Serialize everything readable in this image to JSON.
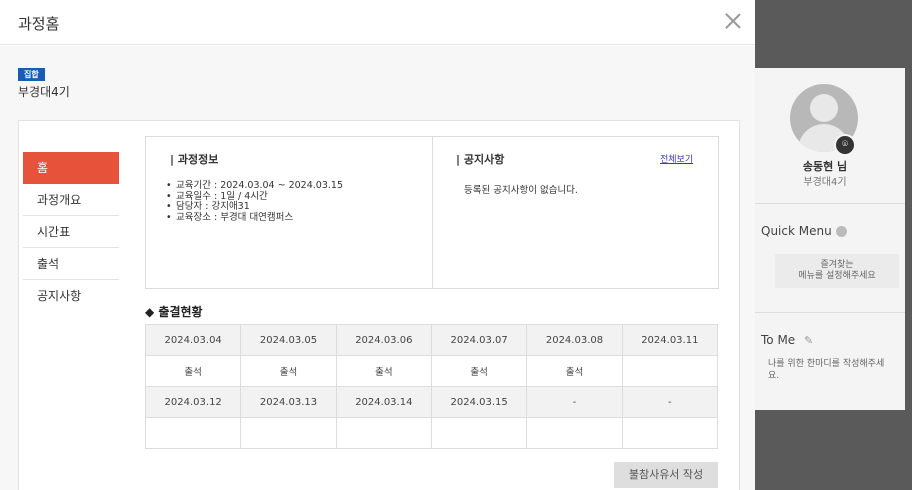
{
  "background": {
    "profile_name": "송동현 님",
    "profile_course": "부경대4기",
    "quick_menu_title": "Quick Menu",
    "quick_menu_text_1": "즐겨찾는",
    "quick_menu_text_2": "메뉴를 설정해주세요",
    "tome_title": "To Me",
    "tome_text": "나를 위한 한마디를 작성해주세요."
  },
  "modal": {
    "title": "과정홈",
    "badge": "집합",
    "course_name": "부경대4기"
  },
  "menu": {
    "items": [
      {
        "label": "홈"
      },
      {
        "label": "과정개요"
      },
      {
        "label": "시간표"
      },
      {
        "label": "출석"
      },
      {
        "label": "공지사항"
      }
    ]
  },
  "course_info": {
    "title": "| 과정정보",
    "items": [
      "교육기간 : 2024.03.04 ~ 2024.03.15",
      "교육일수 : 1일 / 4시간",
      "담당자 : 강지애31",
      "교육장소 : 부경대 대연캠퍼스"
    ]
  },
  "notice": {
    "title": "| 공지사항",
    "view_all": "전체보기",
    "empty_text": "등록된 공지사항이 없습니다."
  },
  "attendance": {
    "title": "◆ 출결현황",
    "rows": [
      {
        "dates": [
          "2024.03.04",
          "2024.03.05",
          "2024.03.06",
          "2024.03.07",
          "2024.03.08",
          "2024.03.11"
        ],
        "marks": [
          "출석",
          "출석",
          "출석",
          "출석",
          "출석",
          ""
        ]
      },
      {
        "dates": [
          "2024.03.12",
          "2024.03.13",
          "2024.03.14",
          "2024.03.15",
          "-",
          "-"
        ],
        "marks": [
          "",
          "",
          "",
          "",
          "",
          ""
        ]
      }
    ]
  },
  "absence_button": "불참사유서 작성"
}
